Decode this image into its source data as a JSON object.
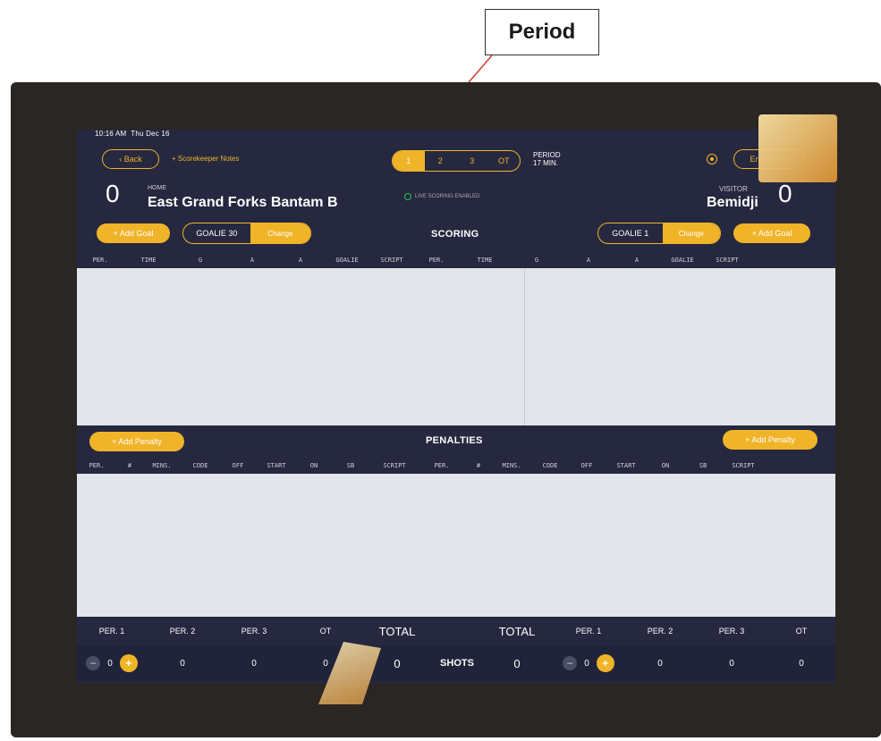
{
  "annotation": {
    "label": "Period"
  },
  "status_bar": {
    "time": "10:16 AM",
    "date": "Thu Dec 16"
  },
  "header": {
    "back_label": "Back",
    "notes_label": "+ Scorekeeper Notes",
    "periods": [
      "1",
      "2",
      "3",
      "OT"
    ],
    "active_period": "1",
    "period_label": "PERIOD",
    "period_minutes": "17 MIN.",
    "end_game_label": "End Game"
  },
  "home": {
    "label": "HOME",
    "name": "East Grand Forks Bantam B",
    "score": "0"
  },
  "visitor": {
    "label": "VISITOR",
    "name": "Bemidji",
    "score": "0"
  },
  "live_badge": "LIVE SCORING ENABLED",
  "scoring": {
    "title": "SCORING",
    "add_goal_label": "+ Add Goal",
    "home_goalie": "GOALIE 30",
    "visitor_goalie": "GOALIE 1",
    "change_label": "Change",
    "columns": [
      "PER.",
      "TIME",
      "G",
      "A",
      "A",
      "GOALIE",
      "SCRIPT"
    ]
  },
  "penalties": {
    "title": "PENALTIES",
    "add_penalty_label": "+ Add Penalty",
    "columns": [
      "PER.",
      "#",
      "MINS.",
      "CODE",
      "OFF",
      "START",
      "ON",
      "SB",
      "SCRIPT"
    ]
  },
  "shots": {
    "label": "SHOTS",
    "period_headers": [
      "PER. 1",
      "PER. 2",
      "PER. 3",
      "OT"
    ],
    "total_label": "TOTAL",
    "home": {
      "per1": "0",
      "per2": "0",
      "per3": "0",
      "ot": "0",
      "total": "0"
    },
    "visitor": {
      "per1": "0",
      "per2": "0",
      "per3": "0",
      "ot": "0",
      "total": "0"
    }
  },
  "colors": {
    "accent": "#f0b429",
    "panel": "#25283f",
    "table_bg": "#e2e6ea"
  }
}
